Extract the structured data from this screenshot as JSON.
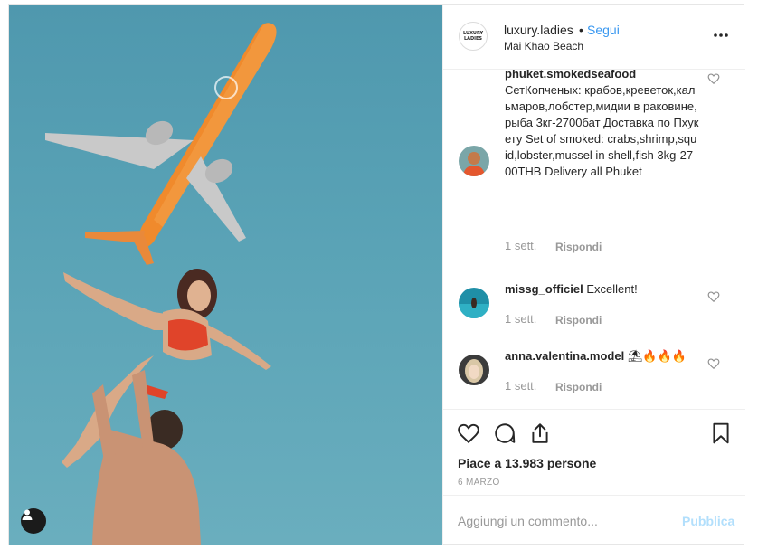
{
  "post": {
    "username": "luxury.ladies",
    "separator": "•",
    "follow_label": "Segui",
    "location": "Mai Khao Beach",
    "avatar_text": "LUXURY LADIES",
    "more_icon": "more-dots-icon"
  },
  "comments": [
    {
      "username": "phuket.smokedseafood",
      "text": "СетКопченых: крабов,креветок,кальмаров,лобстер,мидии в раковине,рыба 3кг-2700бат Доставка по Пхукету Set of smoked: crabs,shrimp,squid,lobster,mussel in shell,fish 3kg-2700THB Delivery all Phuket",
      "time": "1 sett.",
      "reply": "Rispondi"
    },
    {
      "username": "missg_officiel",
      "text": "Excellent!",
      "time": "1 sett.",
      "reply": "Rispondi"
    },
    {
      "username": "anna.valentina.model",
      "text": "⛱🔥🔥🔥",
      "time": "1 sett.",
      "reply": "Rispondi"
    }
  ],
  "likes_text": "Piace a 13.983 persone",
  "date_text": "6 MARZO",
  "add_comment": {
    "placeholder": "Aggiungi un commento...",
    "publish": "Pubblica"
  },
  "colors": {
    "link": "#3897f0",
    "publish_disabled": "#b2dffc",
    "meta": "#999999",
    "sky": "#5aa3b6",
    "plane": "#f08a2c"
  },
  "icons": [
    "heart-icon",
    "comment-icon",
    "share-icon",
    "bookmark-icon",
    "user-tag-icon"
  ]
}
